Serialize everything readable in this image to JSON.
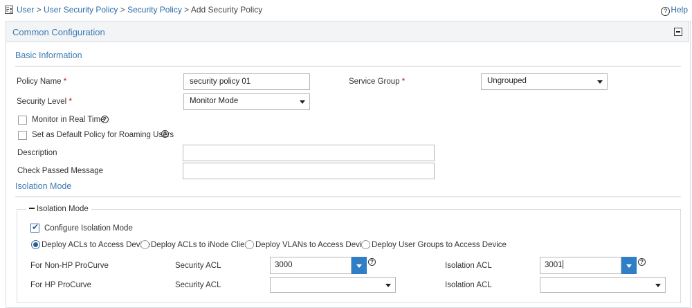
{
  "breadcrumb": {
    "icon": "user-policy-icon",
    "items": [
      {
        "label": "User"
      },
      {
        "label": "User Security Policy"
      },
      {
        "label": "Security Policy"
      },
      {
        "label": "Add Security Policy"
      }
    ],
    "separator": ">"
  },
  "help": {
    "icon": "help-circle-icon",
    "label": "Help"
  },
  "panel": {
    "title": "Common Configuration",
    "collapse_icon": "minus-box-icon"
  },
  "basic": {
    "title": "Basic Information",
    "policy_name": {
      "label": "Policy Name",
      "required": "*",
      "value": "security policy 01"
    },
    "service_group": {
      "label": "Service Group",
      "required": "*",
      "value": "Ungrouped"
    },
    "security_level": {
      "label": "Security Level",
      "required": "*",
      "value": "Monitor Mode"
    },
    "monitor_realtime": {
      "label": "Monitor in Real Time",
      "checked": false
    },
    "default_roaming": {
      "label": "Set as Default Policy for Roaming Users",
      "checked": false
    },
    "description": {
      "label": "Description",
      "value": ""
    },
    "check_passed": {
      "label": "Check Passed Message",
      "value": ""
    },
    "help_glyph": "?"
  },
  "isolation": {
    "title": "Isolation Mode",
    "group_label": "Isolation Mode",
    "configure": {
      "label": "Configure Isolation Mode",
      "checked": true
    },
    "check_glyph": "✔",
    "options": [
      {
        "label": "Deploy ACLs to Access Device",
        "selected": true
      },
      {
        "label": "Deploy ACLs to iNode Client",
        "selected": false
      },
      {
        "label": "Deploy VLANs to Access Device",
        "selected": false
      },
      {
        "label": "Deploy User Groups to Access Device",
        "selected": false
      }
    ],
    "rows": [
      {
        "device": "For Non-HP ProCurve",
        "security_acl_label": "Security ACL",
        "security_acl": "3000",
        "isolation_acl_label": "Isolation ACL",
        "isolation_acl": "3001"
      },
      {
        "device": "For HP ProCurve",
        "security_acl_label": "Security ACL",
        "security_acl": "",
        "isolation_acl_label": "Isolation ACL",
        "isolation_acl": ""
      }
    ]
  },
  "colors": {
    "link": "#2a6aa8",
    "section_title": "#3d7ab3",
    "accent_button": "#2f7ec6",
    "required": "#d40000"
  }
}
